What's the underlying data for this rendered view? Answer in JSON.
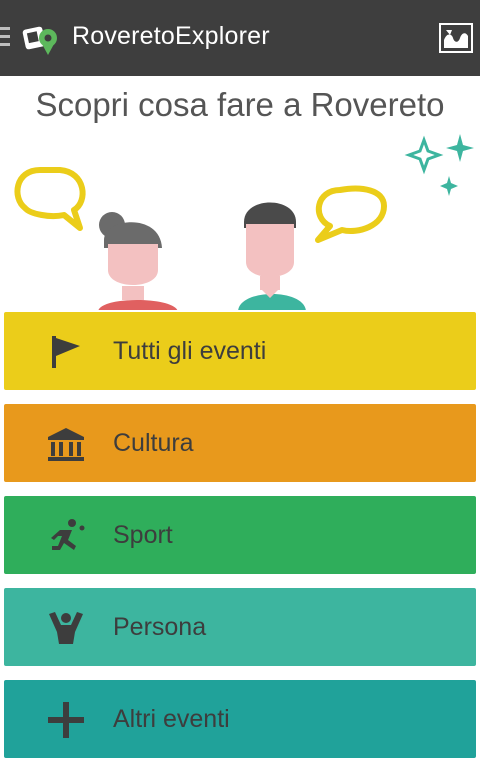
{
  "appbar": {
    "title": "RoveretoExplorer",
    "menu_icon": "hamburger-icon",
    "logo_icon": "app-logo-icon",
    "map_icon": "map-icon",
    "background": "#3e3e3e"
  },
  "main": {
    "headline": "Scopri cosa fare a Rovereto"
  },
  "menu": {
    "items": [
      {
        "label": "Tutti gli eventi",
        "icon": "flag-icon",
        "color": "#ebcd1a"
      },
      {
        "label": "Cultura",
        "icon": "museum-icon",
        "color": "#e8991c"
      },
      {
        "label": "Sport",
        "icon": "running-icon",
        "color": "#2fae5b"
      },
      {
        "label": "Persona",
        "icon": "person-cheering-icon",
        "color": "#3db59f"
      },
      {
        "label": "Altri eventi",
        "icon": "plus-icon",
        "color": "#20a29a"
      }
    ]
  }
}
